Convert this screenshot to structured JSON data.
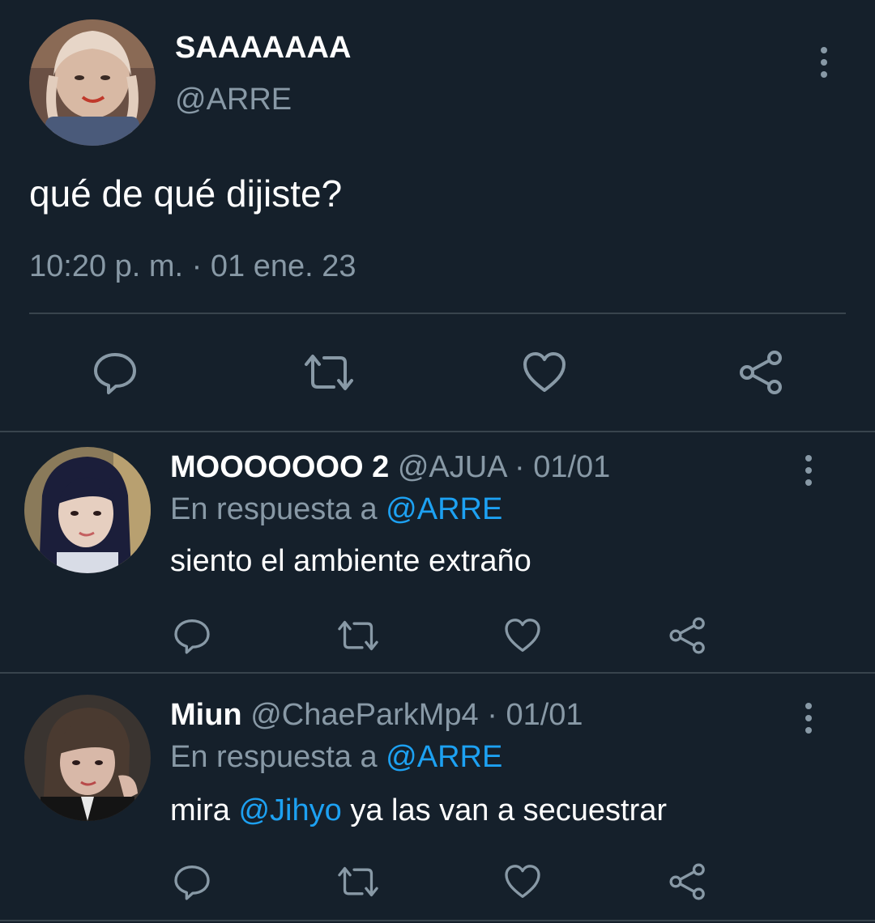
{
  "main_tweet": {
    "display_name": "SAAAAAAA",
    "handle": "@ARRE",
    "text": "qué de qué dijiste?",
    "timestamp": "10:20 p. m. · 01 ene. 23",
    "avatar_icon": "avatar-photo"
  },
  "replies": [
    {
      "display_name": "MOOOOOOO 2",
      "handle": "@AJUA",
      "date": "· 01/01",
      "reply_prefix": "En respuesta a",
      "reply_to": "@ARRE",
      "text_parts": [
        "siento el ambiente extraño"
      ]
    },
    {
      "display_name": "Miun",
      "handle": "@ChaeParkMp4",
      "date": "· 01/01",
      "reply_prefix": "En respuesta a",
      "reply_to": "@ARRE",
      "text_parts": [
        "mira",
        "@Jihyo",
        "ya las van a secuestrar"
      ]
    }
  ],
  "colors": {
    "background": "#15202b",
    "muted_text": "#8899a6",
    "link": "#1da1f2",
    "divider": "#38444d"
  },
  "icons": [
    "reply-icon",
    "retweet-icon",
    "like-icon",
    "share-icon",
    "more-options-icon"
  ]
}
